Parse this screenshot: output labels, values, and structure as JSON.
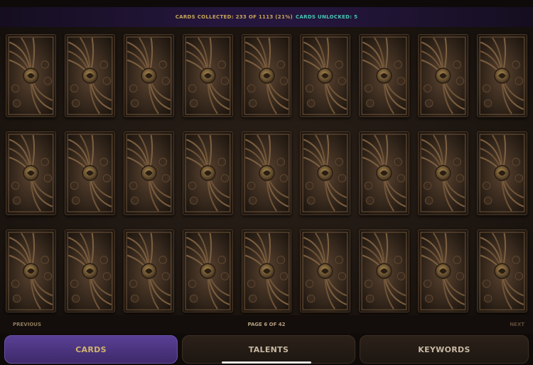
{
  "status": {
    "cards_collected": "CARDS COLLECTED: 233 OF 1113 (21%)",
    "cards_unlocked": "CARDS UNLOCKED: 5"
  },
  "grid": {
    "rows": 3,
    "columns": 9,
    "card_label": "card-back"
  },
  "pager": {
    "previous": "PREVIOUS",
    "page": "PAGE 6 OF 42",
    "next": "NEXT"
  },
  "tabs": [
    {
      "label": "CARDS",
      "active": true
    },
    {
      "label": "TALENTS",
      "active": false
    },
    {
      "label": "KEYWORDS",
      "active": false
    }
  ],
  "colors": {
    "accent_gold": "#c9a85a",
    "accent_teal": "#47c7b4",
    "active_tab": "#4a347f"
  }
}
